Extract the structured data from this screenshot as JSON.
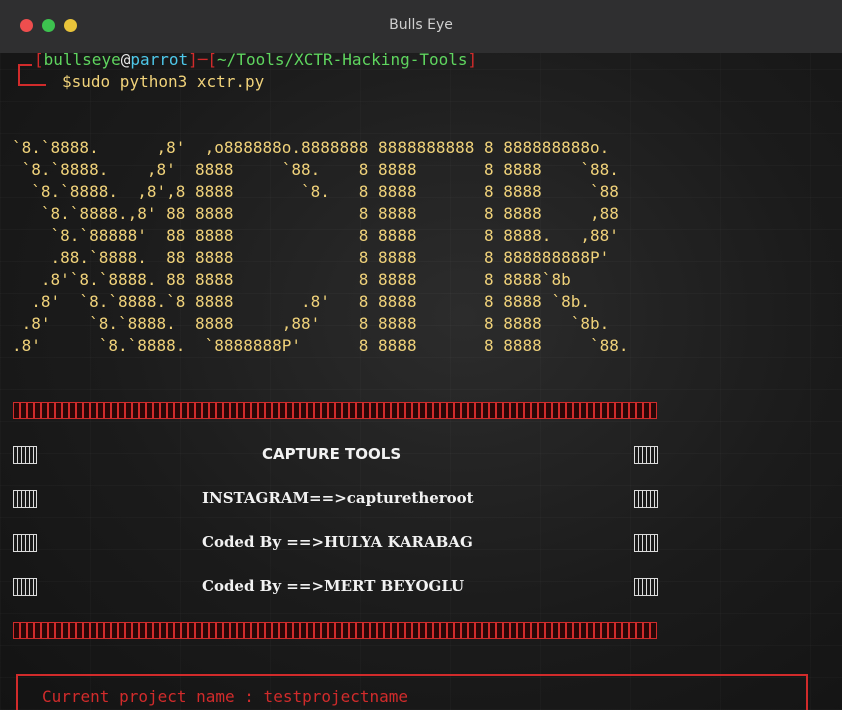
{
  "window": {
    "title": "Bulls Eye"
  },
  "prompt": {
    "user": "bullseye",
    "at": "@",
    "host": "parrot",
    "path": "~/Tools/XCTR-Hacking-Tools",
    "symbol": "$",
    "command": "sudo python3 xctr.py"
  },
  "banner": {
    "lines": [
      "`8.`8888.      ,8'  ,o888888o.8888888 8888888888 8 888888888o.",
      " `8.`8888.    ,8'  8888     `88.    8 8888       8 8888    `88.",
      "  `8.`8888.  ,8',8 8888       `8.   8 8888       8 8888     `88",
      "   `8.`8888.,8' 88 8888             8 8888       8 8888     ,88",
      "    `8.`88888'  88 8888             8 8888       8 8888.   ,88'",
      "    .88.`8888.  88 8888             8 8888       8 888888888P'",
      "   .8'`8.`8888. 88 8888             8 8888       8 8888`8b",
      "  .8'  `8.`8888.`8 8888       .8'   8 8888       8 8888 `8b.",
      " .8'    `8.`8888.  8888     ,88'    8 8888       8 8888   `8b.",
      ".8'      `8.`8888.  `8888888P'      8 8888       8 8888     `88."
    ]
  },
  "menu": {
    "heading": "CAPTURE TOOLS",
    "lines": [
      "INSTAGRAM==>capturetheroot",
      "Coded By ==>HULYA KARABAG",
      "Coded By ==>MERT BEYOGLU"
    ]
  },
  "project": {
    "label": "Current project name : testprojectname"
  },
  "colors": {
    "red": "#d12b2b",
    "green": "#5fd55f",
    "cyan": "#4ec8ea",
    "yellow": "#f0d27a"
  }
}
